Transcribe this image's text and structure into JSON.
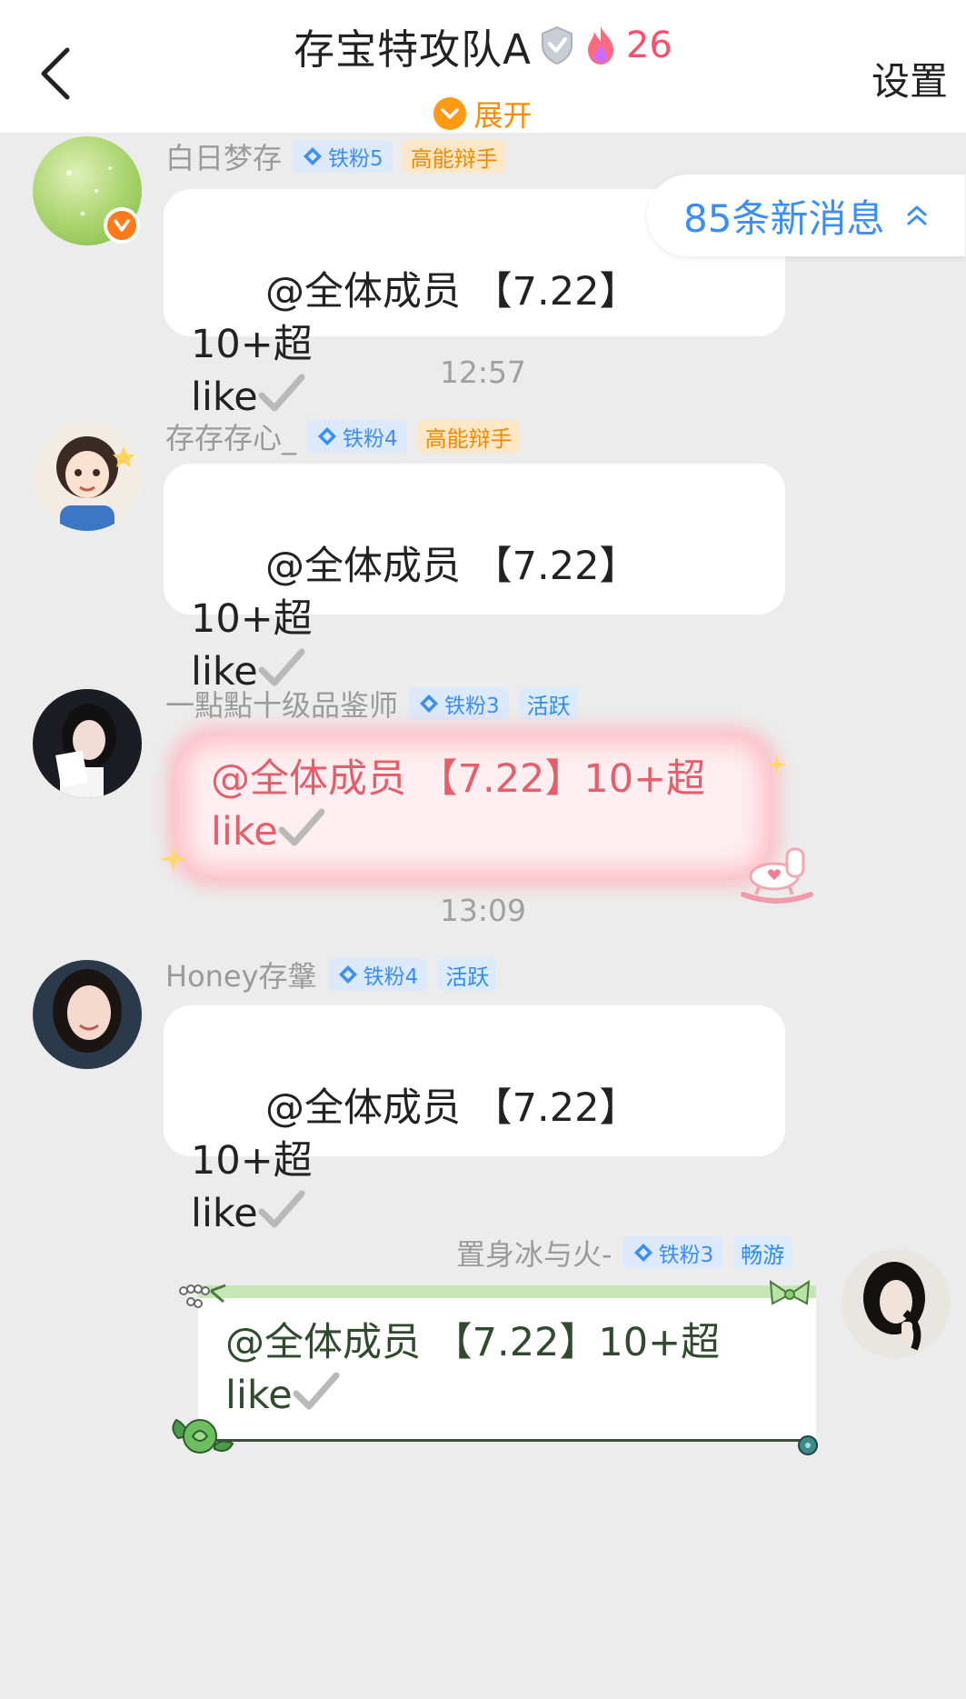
{
  "header": {
    "title": "存宝特攻队A",
    "fire_count": "26",
    "expand_label": "展开",
    "settings_label": "设置"
  },
  "new_messages_pill": "85条新消息",
  "timestamps": [
    "12:57",
    "13:09"
  ],
  "messages": [
    {
      "sender": "白日梦存",
      "fan_level": "铁粉5",
      "title": "高能辩手",
      "text": "@全体成员 【7.22】10+超\nlike"
    },
    {
      "sender": "存存存心_",
      "fan_level": "铁粉4",
      "title": "高能辩手",
      "text": "@全体成员 【7.22】10+超\nlike"
    },
    {
      "sender": "一點點十级品鉴师",
      "fan_level": "铁粉3",
      "title": "活跃",
      "text": "@全体成员 【7.22】10+超\nlike"
    },
    {
      "sender": "Honey存鞶",
      "fan_level": "铁粉4",
      "title": "活跃",
      "text": "@全体成员 【7.22】10+超\nlike"
    },
    {
      "sender": "置身冰与火-",
      "fan_level": "铁粉3",
      "title": "畅游",
      "text": "@全体成员 【7.22】10+超\nlike"
    }
  ],
  "icons": {
    "back": "chevron-left-icon",
    "verified": "verified-shield-icon",
    "fire": "fire-icon",
    "expand": "chevron-down-icon",
    "fan": "diamond-icon",
    "check": "checkmark-icon",
    "scroll_up": "double-chevron-up-icon"
  },
  "colors": {
    "accent_orange": "#ff8a00",
    "accent_blue": "#3a8ef6",
    "fire_count": "#ff4d6d"
  }
}
